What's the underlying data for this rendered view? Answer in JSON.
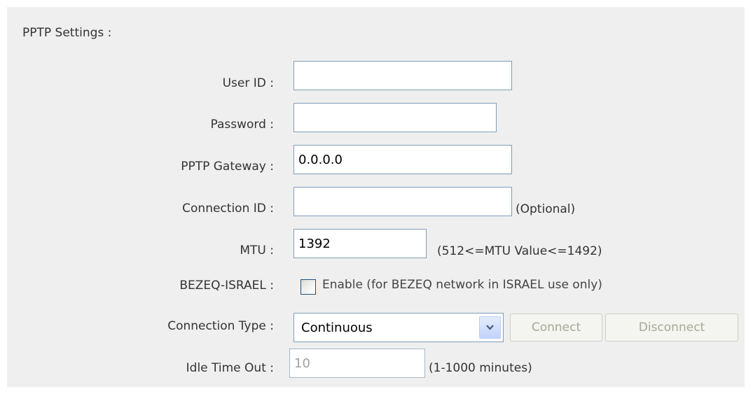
{
  "section": {
    "title": "PPTP Settings :"
  },
  "form": {
    "user_id": {
      "label": "User ID :",
      "value": ""
    },
    "password": {
      "label": "Password :",
      "value": ""
    },
    "pptp_gateway": {
      "label": "PPTP Gateway :",
      "value": "0.0.0.0"
    },
    "connection_id": {
      "label": "Connection ID :",
      "value": "",
      "hint": "(Optional)"
    },
    "mtu": {
      "label": "MTU :",
      "value": "1392",
      "hint": "(512<=MTU Value<=1492)"
    },
    "bezeq": {
      "label": "BEZEQ-ISRAEL :",
      "checkbox_label": "Enable (for BEZEQ network in ISRAEL use only)",
      "checked": false
    },
    "connection_type": {
      "label": "Connection Type :",
      "selected": "Continuous",
      "connect_label": "Connect",
      "disconnect_label": "Disconnect"
    },
    "idle_time_out": {
      "label": "Idle Time Out :",
      "value": "10",
      "hint": "(1-1000 minutes)"
    }
  }
}
